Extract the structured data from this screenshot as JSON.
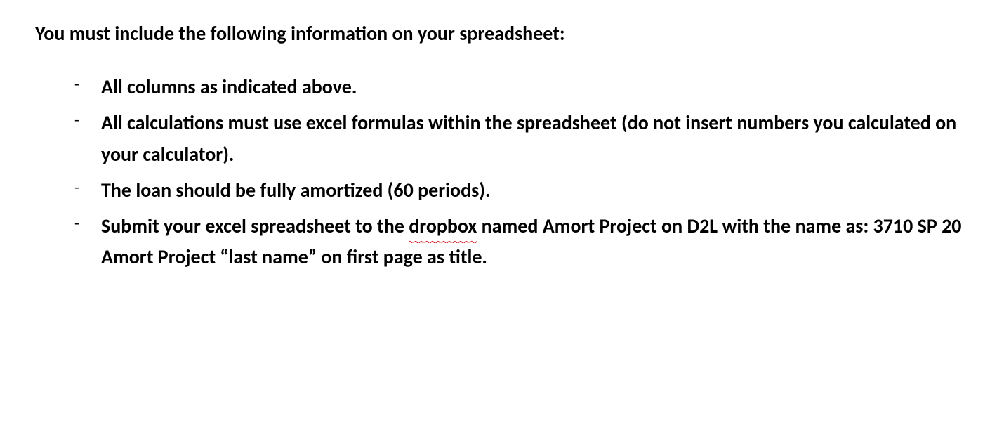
{
  "heading": "You must include the following information on your spreadsheet:",
  "bulletChar": "-",
  "items": [
    {
      "text": "All columns as indicated above."
    },
    {
      "text": "All calculations must use excel formulas within the spreadsheet (do not insert numbers you calculated on your calculator)."
    },
    {
      "text": "The loan should be fully amortized (60 periods)."
    },
    {
      "prefix": "Submit your excel spreadsheet to the ",
      "spellcheck_word": "dropbox",
      "suffix": " named Amort Project on D2L with the name as: 3710 SP 20 Amort Project “last name” on first page as title."
    }
  ]
}
